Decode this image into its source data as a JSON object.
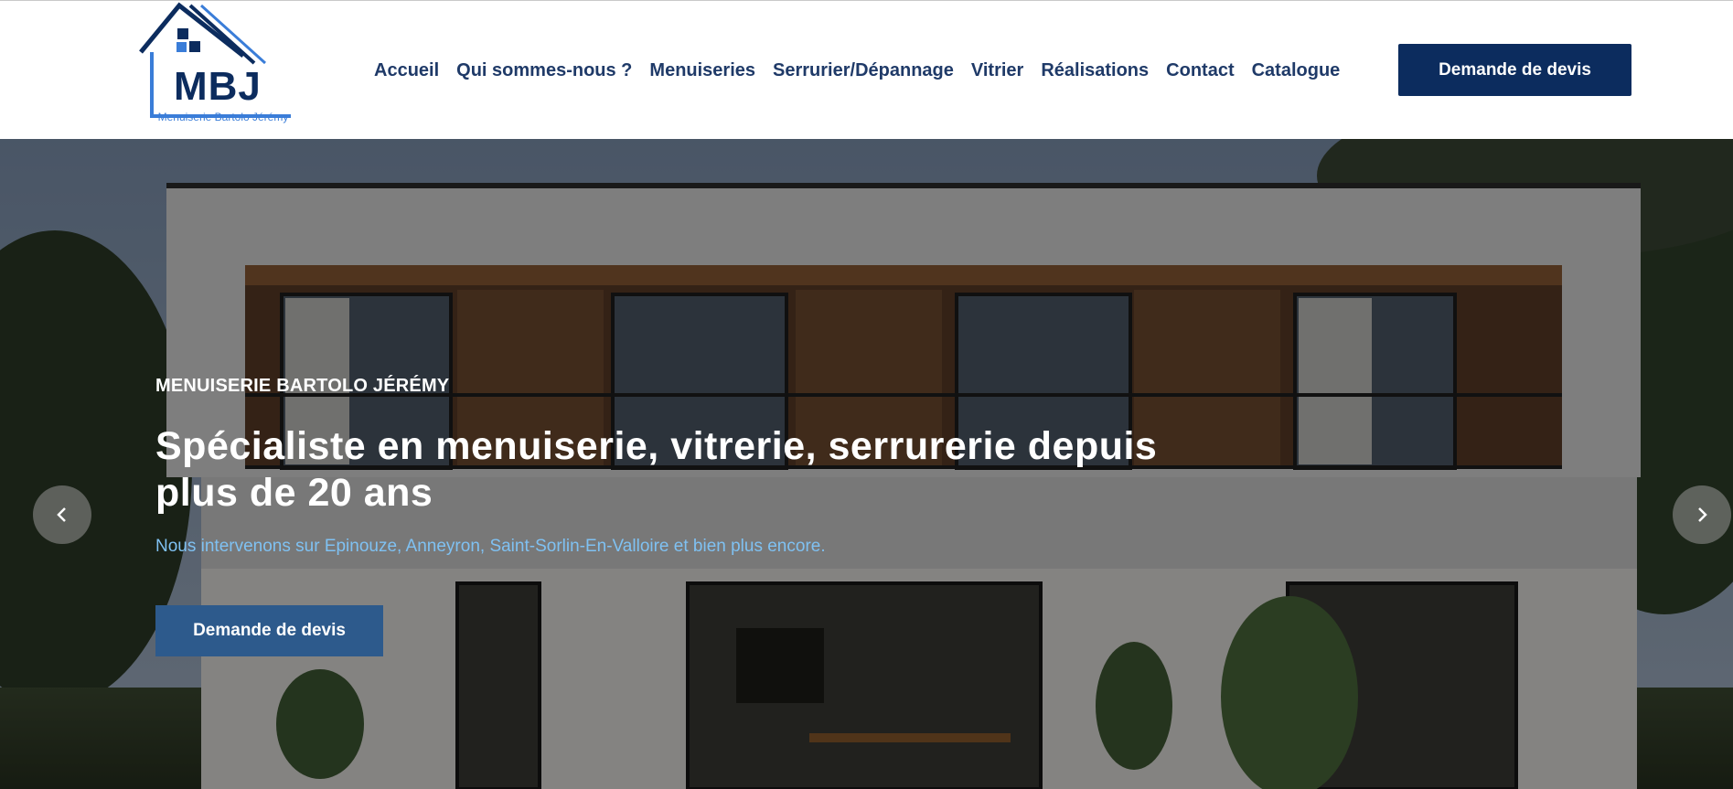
{
  "brand": {
    "logo_letters": "MBJ",
    "logo_tagline": "Menuiserie Bartolo Jérémy",
    "primary_color": "#0c2c5e",
    "accent_color": "#3a7dd8"
  },
  "nav": {
    "items": [
      {
        "label": "Accueil"
      },
      {
        "label": "Qui sommes-nous ?"
      },
      {
        "label": "Menuiseries"
      },
      {
        "label": "Serrurier/Dépannage"
      },
      {
        "label": "Vitrier"
      },
      {
        "label": "Réalisations"
      },
      {
        "label": "Contact"
      },
      {
        "label": "Catalogue"
      }
    ],
    "cta_label": "Demande de devis"
  },
  "hero": {
    "eyebrow": "MENUISERIE BARTOLO JÉRÉMY",
    "title": "Spécialiste en menuiserie, vitrerie, serrurerie depuis plus de 20 ans",
    "subtitle": "Nous intervenons sur Epinouze, Anneyron, Saint-Sorlin-En-Valloire et bien plus encore.",
    "cta_label": "Demande de devis",
    "prev_icon": "chevron-left-icon",
    "next_icon": "chevron-right-icon"
  }
}
